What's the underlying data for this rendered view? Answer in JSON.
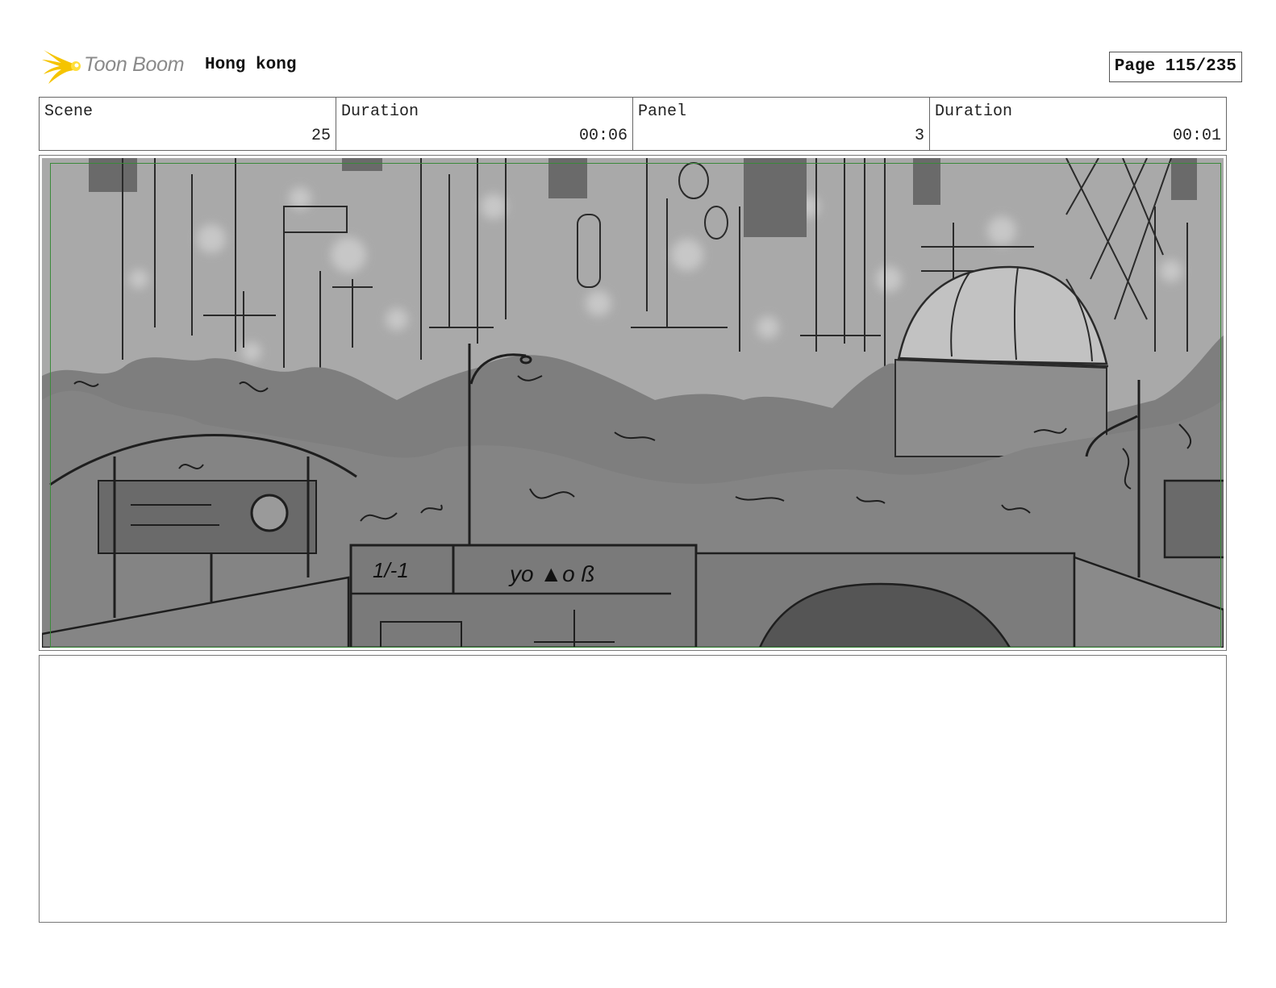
{
  "header": {
    "logo_text": "Toon Boom",
    "project_title": "Hong kong",
    "page_label": "Page 115/235"
  },
  "info": {
    "scene_label": "Scene",
    "scene_value": "25",
    "scene_duration_label": "Duration",
    "scene_duration_value": "00:06",
    "panel_label": "Panel",
    "panel_value": "3",
    "panel_duration_label": "Duration",
    "panel_duration_value": "00:01"
  },
  "panel": {
    "sign_left_text": "1/-1",
    "sign_right_text": "yo ▲o ß"
  },
  "notes": {
    "text": ""
  },
  "colors": {
    "safe_area": "#3a8a3a",
    "logo_flame": "#f5c400",
    "logo_text": "#8a8a8a"
  }
}
